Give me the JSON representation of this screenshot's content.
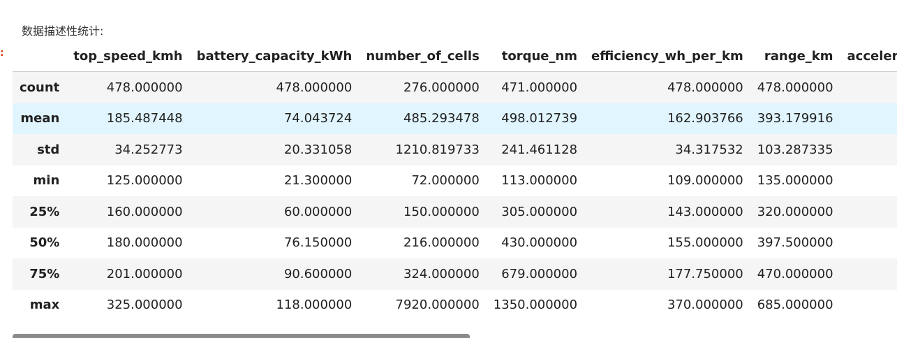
{
  "caption": "数据描述性统计:",
  "prompt_marker": ":",
  "table": {
    "columns": [
      "top_speed_kmh",
      "battery_capacity_kWh",
      "number_of_cells",
      "torque_nm",
      "efficiency_wh_per_km",
      "range_km",
      "accelerati"
    ],
    "rows": [
      {
        "label": "count",
        "values": [
          "478.000000",
          "478.000000",
          "276.000000",
          "471.000000",
          "478.000000",
          "478.000000",
          ""
        ]
      },
      {
        "label": "mean",
        "values": [
          "185.487448",
          "74.043724",
          "485.293478",
          "498.012739",
          "162.903766",
          "393.179916",
          ""
        ]
      },
      {
        "label": "std",
        "values": [
          "34.252773",
          "20.331058",
          "1210.819733",
          "241.461128",
          "34.317532",
          "103.287335",
          ""
        ]
      },
      {
        "label": "min",
        "values": [
          "125.000000",
          "21.300000",
          "72.000000",
          "113.000000",
          "109.000000",
          "135.000000",
          ""
        ]
      },
      {
        "label": "25%",
        "values": [
          "160.000000",
          "60.000000",
          "150.000000",
          "305.000000",
          "143.000000",
          "320.000000",
          ""
        ]
      },
      {
        "label": "50%",
        "values": [
          "180.000000",
          "76.150000",
          "216.000000",
          "430.000000",
          "155.000000",
          "397.500000",
          ""
        ]
      },
      {
        "label": "75%",
        "values": [
          "201.000000",
          "90.600000",
          "324.000000",
          "679.000000",
          "177.750000",
          "470.000000",
          ""
        ]
      },
      {
        "label": "max",
        "values": [
          "325.000000",
          "118.000000",
          "7920.000000",
          "1350.000000",
          "370.000000",
          "685.000000",
          ""
        ]
      }
    ],
    "hover_row_index": 1
  },
  "colors": {
    "row_stripe": "#f5f5f5",
    "row_hover": "#e1f5fe",
    "scrollbar": "#8a8a8a",
    "prompt": "#d84315"
  }
}
